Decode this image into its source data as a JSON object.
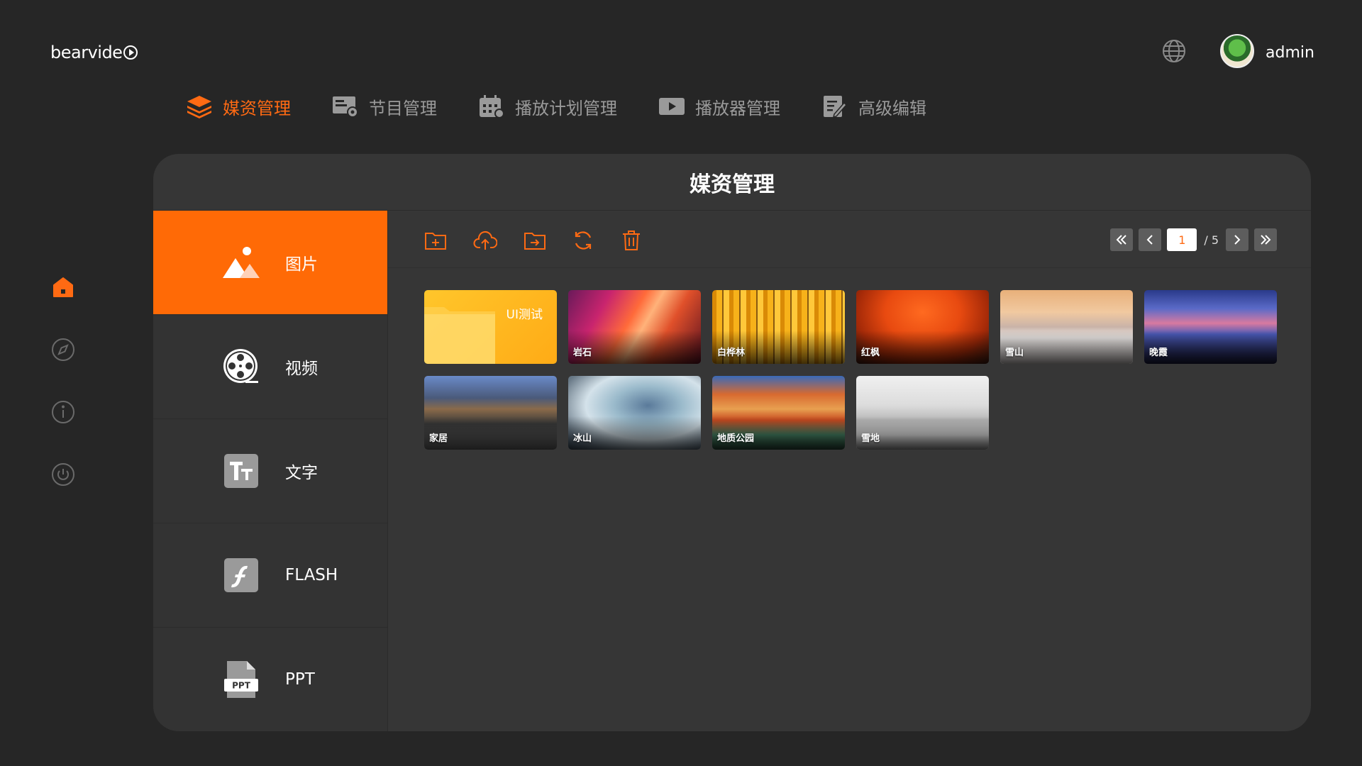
{
  "header": {
    "logo_text": "bearvide",
    "username": "admin"
  },
  "topnav": [
    {
      "label": "媒资管理",
      "icon": "stack-icon",
      "active": true
    },
    {
      "label": "节目管理",
      "icon": "program-icon",
      "active": false
    },
    {
      "label": "播放计划管理",
      "icon": "calendar-icon",
      "active": false
    },
    {
      "label": "播放器管理",
      "icon": "player-icon",
      "active": false
    },
    {
      "label": "高级编辑",
      "icon": "edit-icon",
      "active": false
    }
  ],
  "sidebar": [
    "home-icon",
    "compass-icon",
    "info-icon",
    "power-icon"
  ],
  "panel": {
    "title": "媒资管理"
  },
  "categories": [
    {
      "label": "图片",
      "icon": "image-icon",
      "active": true
    },
    {
      "label": "视频",
      "icon": "film-reel-icon",
      "active": false
    },
    {
      "label": "文字",
      "icon": "text-icon",
      "active": false
    },
    {
      "label": "FLASH",
      "icon": "flash-icon",
      "active": false
    },
    {
      "label": "PPT",
      "icon": "ppt-file-icon",
      "active": false
    }
  ],
  "toolbar": [
    "new-folder-icon",
    "upload-icon",
    "move-folder-icon",
    "refresh-icon",
    "delete-icon"
  ],
  "pager": {
    "current": "1",
    "total": "/ 5"
  },
  "tiles": [
    {
      "label": "UI测试",
      "type": "folder"
    },
    {
      "label": "岩石",
      "type": "image"
    },
    {
      "label": "白桦林",
      "type": "image"
    },
    {
      "label": "红枫",
      "type": "image"
    },
    {
      "label": "雪山",
      "type": "image"
    },
    {
      "label": "晚霞",
      "type": "image"
    },
    {
      "label": "家居",
      "type": "image"
    },
    {
      "label": "冰山",
      "type": "image"
    },
    {
      "label": "地质公园",
      "type": "image"
    },
    {
      "label": "雪地",
      "type": "image"
    }
  ],
  "colors": {
    "accent": "#ff6a13",
    "background": "#262626",
    "panel": "#363636"
  }
}
